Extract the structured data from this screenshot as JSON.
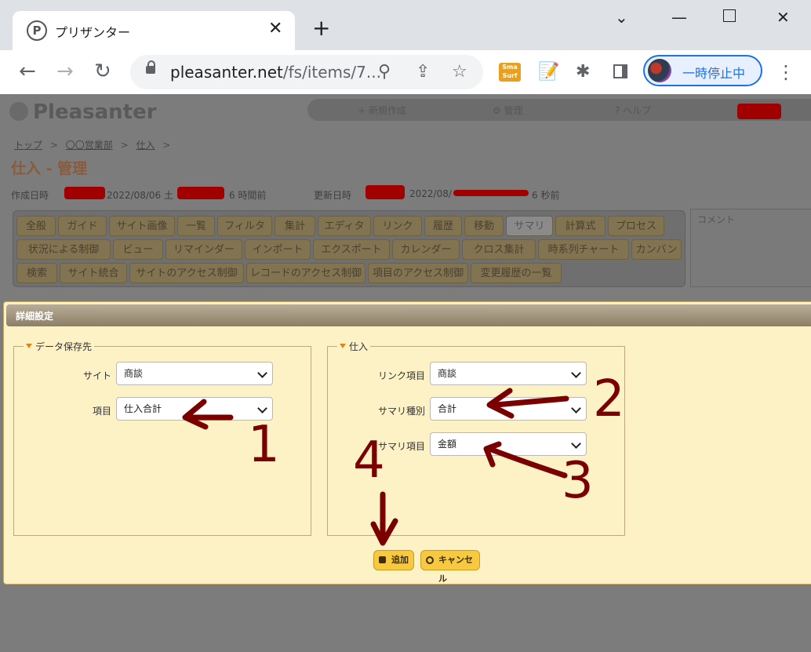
{
  "browser": {
    "tab_title": "プリザンター",
    "tab_favicon": "P",
    "url_host": "pleasanter.net",
    "url_path": "/fs/items/7...",
    "profile_label": "一時停止中"
  },
  "app": {
    "logo": "Pleasanter",
    "nav": [
      "+ 新規作成",
      "⚙ 管理",
      "? ヘルプ"
    ],
    "breadcrumb": [
      "トップ",
      "〇〇営業部",
      "仕入"
    ],
    "breadcrumb_sep": ">",
    "title": "仕入 - 管理",
    "created_label": "作成日時",
    "created_date": "2022/08/06 土",
    "created_ago": "6 時間前",
    "updated_label": "更新日時",
    "updated_date": "2022/08/",
    "updated_ago": "6 秒前",
    "tabs_row1": [
      "全般",
      "ガイド",
      "サイト画像",
      "一覧",
      "フィルタ",
      "集計",
      "エディタ",
      "リンク",
      "履歴",
      "移動",
      "サマリ",
      "計算式",
      "プロセス"
    ],
    "tabs_row2": [
      "状況による制御",
      "ビュー",
      "リマインダー",
      "インポート",
      "エクスポート",
      "カレンダー",
      "クロス集計",
      "時系列チャート",
      "カンバン"
    ],
    "tabs_row3": [
      "検索",
      "サイト統合",
      "サイトのアクセス制御",
      "レコードのアクセス制御",
      "項目のアクセス制御",
      "変更履歴の一覧"
    ],
    "active_tab": "サマリ",
    "comment_placeholder": "コメント"
  },
  "dialog": {
    "title": "詳細設定",
    "left_legend": "データ保存先",
    "site_label": "サイト",
    "site_value": "商談",
    "item_label": "項目",
    "item_value": "仕入合計",
    "right_legend": "仕入",
    "link_label": "リンク項目",
    "link_value": "商談",
    "summary_type_label": "サマリ種別",
    "summary_type_value": "合計",
    "summary_item_label": "サマリ項目",
    "summary_item_value": "金額",
    "add_button": "追加",
    "cancel_button": "キャンセル"
  },
  "annotations": [
    "1",
    "2",
    "3",
    "4"
  ],
  "colors": {
    "annotation": "#7a0000",
    "button": "#f7c940",
    "dialog_bg": "#fdf1c6",
    "redaction": "#a00000"
  }
}
